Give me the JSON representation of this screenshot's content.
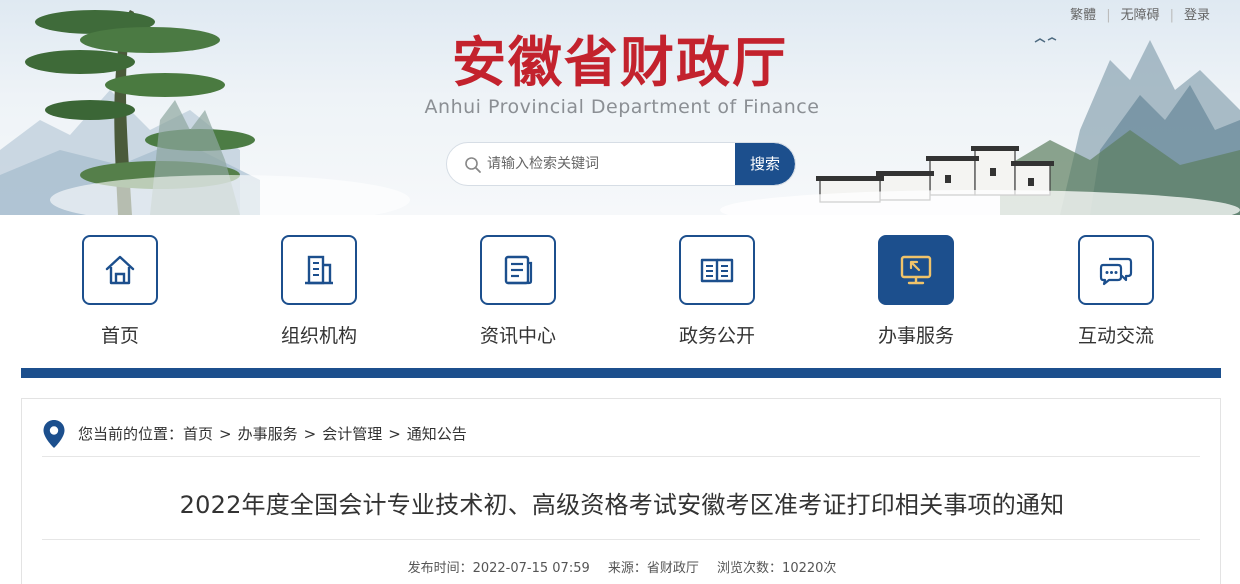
{
  "colors": {
    "brand_blue": "#1c4f8d",
    "title_red": "#c3222d"
  },
  "top_links": {
    "traditional": "繁體",
    "accessibility": "无障碍",
    "login": "登录"
  },
  "header": {
    "title": "安徽省财政厅",
    "subtitle": "Anhui Provincial Department of Finance"
  },
  "search": {
    "placeholder": "请输入检索关键词",
    "button_label": "搜索"
  },
  "nav": {
    "items": [
      {
        "label": "首页",
        "icon": "home-icon"
      },
      {
        "label": "组织机构",
        "icon": "building-icon"
      },
      {
        "label": "资讯中心",
        "icon": "news-icon"
      },
      {
        "label": "政务公开",
        "icon": "open-book-icon"
      },
      {
        "label": "办事服务",
        "icon": "monitor-cursor-icon",
        "active": true
      },
      {
        "label": "互动交流",
        "icon": "chat-bubbles-icon"
      }
    ]
  },
  "breadcrumb": {
    "prefix": "您当前的位置：",
    "items": [
      "首页",
      "办事服务",
      "会计管理",
      "通知公告"
    ],
    "separator": ">"
  },
  "article": {
    "title": "2022年度全国会计专业技术初、高级资格考试安徽考区准考证打印相关事项的通知",
    "publish_time": "发布时间：2022-07-15 07:59",
    "source": "来源：省财政厅",
    "views": "浏览次数：10220次"
  }
}
